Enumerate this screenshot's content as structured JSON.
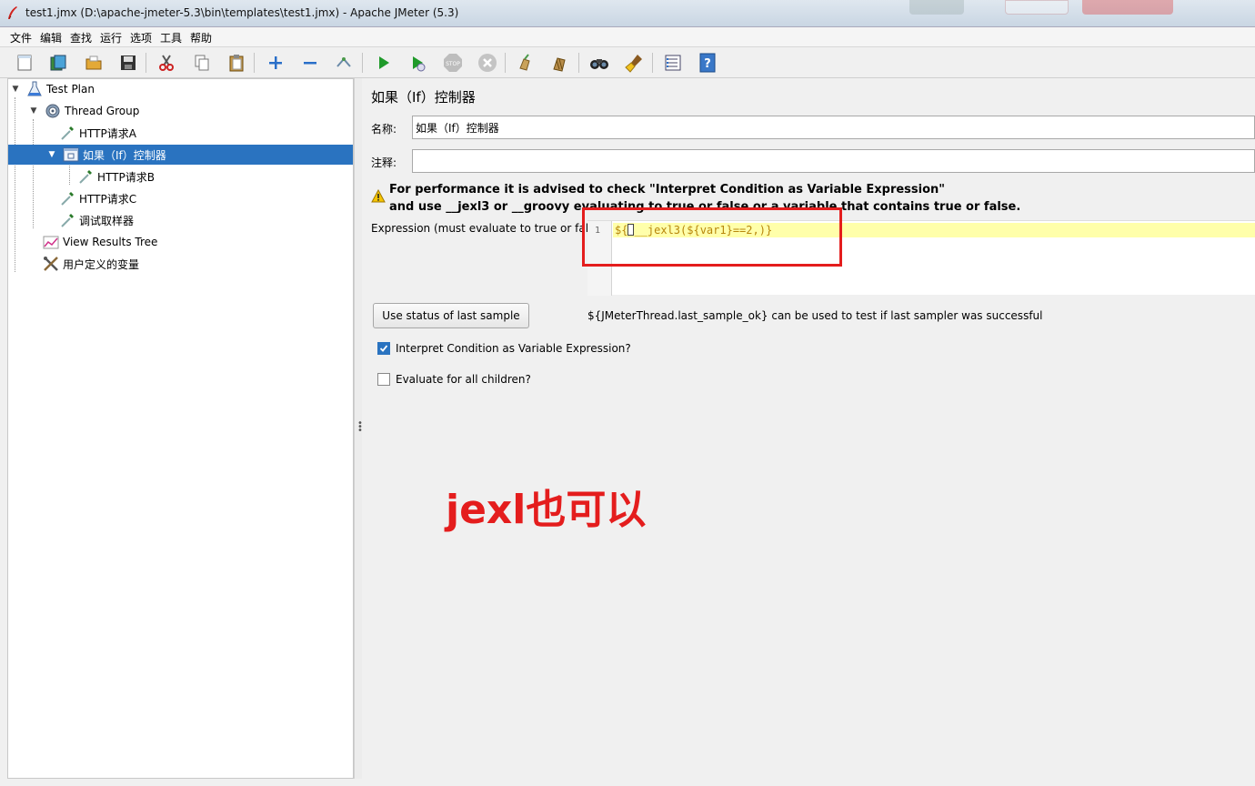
{
  "window": {
    "title": "test1.jmx (D:\\apache-jmeter-5.3\\bin\\templates\\test1.jmx) - Apache JMeter (5.3)"
  },
  "menu": [
    "文件",
    "编辑",
    "查找",
    "运行",
    "选项",
    "工具",
    "帮助"
  ],
  "toolbar": {
    "icons": [
      "new-icon",
      "templates-icon",
      "open-icon",
      "save-icon",
      "cut-icon",
      "copy-icon",
      "paste-icon",
      "expand-icon",
      "collapse-icon",
      "toggle-icon",
      "start-icon",
      "start-no-pauses-icon",
      "stop-icon",
      "shutdown-icon",
      "clear-icon",
      "clear-all-icon",
      "search-icon",
      "reset-search-icon",
      "function-helper-icon",
      "help-icon"
    ]
  },
  "tree": {
    "items": [
      {
        "label": "Test Plan",
        "icon": "test-plan-icon"
      },
      {
        "label": "Thread Group",
        "icon": "gear-icon"
      },
      {
        "label": "HTTP请求A",
        "icon": "pipette-icon"
      },
      {
        "label": "如果（If）控制器",
        "icon": "controller-icon",
        "selected": true
      },
      {
        "label": "HTTP请求B",
        "icon": "pipette-icon"
      },
      {
        "label": "HTTP请求C",
        "icon": "pipette-icon"
      },
      {
        "label": "调试取样器",
        "icon": "pipette-icon"
      },
      {
        "label": "View Results Tree",
        "icon": "graph-icon"
      },
      {
        "label": "用户定义的变量",
        "icon": "tools-icon"
      }
    ]
  },
  "panel": {
    "title": "如果（If）控制器",
    "name_label": "名称:",
    "name_value": "如果（If）控制器",
    "comment_label": "注释:",
    "comment_value": "",
    "warning_line1": "For performance it is advised to check \"Interpret Condition as Variable Expression\"",
    "warning_line2": "and use __jexl3 or __groovy evaluating to true or false or a variable that contains true or false.",
    "expression_label": "Expression (must evaluate to true or false)",
    "line_number": "1",
    "code_prefix": "${",
    "code_rest": "__jexl3(${var1}==2,)}",
    "button_label": "Use status of last sample",
    "hint": "${JMeterThread.last_sample_ok} can be used to test if last sampler was successful",
    "checkbox1_label": "Interpret Condition as Variable Expression?",
    "checkbox1_checked": true,
    "checkbox2_label": "Evaluate for all children?",
    "checkbox2_checked": false
  },
  "annotation": {
    "text": "jexl也可以",
    "color": "#e41d1d"
  },
  "colors": {
    "selection": "#2a73c0",
    "line_highlight": "#ffffaa"
  }
}
